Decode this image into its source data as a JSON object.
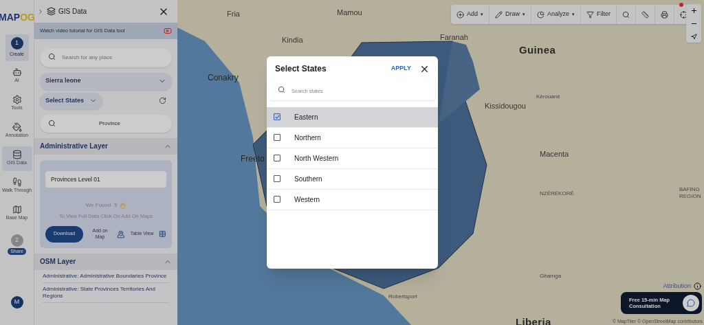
{
  "logo": {
    "text_a": "MAP",
    "text_b": "OG"
  },
  "rail": {
    "steps": [
      {
        "number": "1",
        "label": "Create",
        "selected": true
      },
      {
        "number": "2",
        "label": "Share",
        "selected": false
      }
    ],
    "items": [
      {
        "label": "AI",
        "selected": false
      },
      {
        "label": "Tools",
        "selected": false
      },
      {
        "label": "Annotation",
        "selected": false
      },
      {
        "label": "GIS Data",
        "selected": true
      },
      {
        "label": "Walk Through",
        "selected": false
      },
      {
        "label": "Base Map",
        "selected": false
      }
    ],
    "avatar": "M"
  },
  "panel": {
    "title": "GIS Data",
    "tutorial": "Watch video tutorial for GIS Data tool",
    "search": {
      "placeholder": "Search for any place"
    },
    "country": "Sierra leone",
    "states_button": "Select States",
    "layer_search": "Province",
    "admin_section": "Administrative Layer",
    "result": {
      "layer": "Provinces Level 01",
      "found": "We Found  5",
      "hint": "To View Full Data Click On Add On Maps",
      "download": "Download",
      "add_on_map": "Add on Map",
      "table_view": "Table View"
    },
    "osm_section": "OSM Layer",
    "osm_items": [
      "Administrative: Administrative Boundaries Province",
      "Administrative: State Provinces Territories And Regions"
    ]
  },
  "toolbar": [
    {
      "kind": "menu",
      "label": "Add",
      "caret": "▾"
    },
    {
      "kind": "menu",
      "label": "Draw",
      "caret": "▾"
    },
    {
      "kind": "menu",
      "label": "Analyze",
      "caret": "▾"
    },
    {
      "kind": "button",
      "label": "Filter"
    },
    {
      "kind": "icon"
    },
    {
      "kind": "icon"
    },
    {
      "kind": "icon"
    },
    {
      "kind": "icon"
    }
  ],
  "map_labels": [
    {
      "text": "Fria",
      "kind": "town"
    },
    {
      "text": "Mamou",
      "kind": "town"
    },
    {
      "text": "Kindia",
      "kind": "town"
    },
    {
      "text": "Faranah",
      "kind": "town"
    },
    {
      "text": "Guinea",
      "kind": "country"
    },
    {
      "text": "Conakry",
      "kind": "city"
    },
    {
      "text": "Freeto",
      "kind": "city"
    },
    {
      "text": "Kissidougou",
      "kind": "town"
    },
    {
      "text": "Kérouané",
      "kind": "small"
    },
    {
      "text": "Macenta",
      "kind": "town"
    },
    {
      "text": "NZÉRÉKORÉ",
      "kind": "small"
    },
    {
      "text": "BAFING",
      "kind": "small"
    },
    {
      "text": "REGION",
      "kind": "small"
    },
    {
      "text": "Gbarnga",
      "kind": "small"
    },
    {
      "text": "Robertsport",
      "kind": "small"
    },
    {
      "text": "Liberia",
      "kind": "country"
    }
  ],
  "attribution": "Attribution",
  "copyright": "© MapTiler © OpenStreetMap contributors",
  "consultation": "Free 15-min Map Consultation",
  "dialog": {
    "title": "Select States",
    "apply": "APPLY",
    "search": {
      "placeholder": "Search states"
    },
    "states": [
      {
        "name": "Eastern",
        "checked": true
      },
      {
        "name": "Northern",
        "checked": false
      },
      {
        "name": "North Western",
        "checked": false
      },
      {
        "name": "Southern",
        "checked": false
      },
      {
        "name": "Western",
        "checked": false
      }
    ]
  }
}
